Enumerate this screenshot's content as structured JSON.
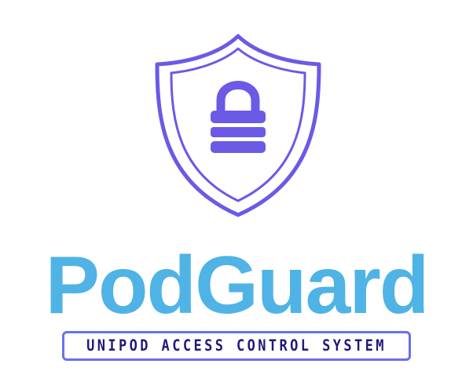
{
  "logo": {
    "brand_name": "PodGuard",
    "tagline": "UNIPOD ACCESS CONTROL SYSTEM"
  },
  "icon": {
    "shield": "shield-icon",
    "lock": "padlock-icon"
  },
  "colors": {
    "shield_stroke": "#6a5ae6",
    "lock_fill": "#6a5ae6",
    "brand_text": "#4fb3e6",
    "tagline_text": "#1f1a7a",
    "tagline_border": "#6a6ff0",
    "background": "#ffffff"
  }
}
